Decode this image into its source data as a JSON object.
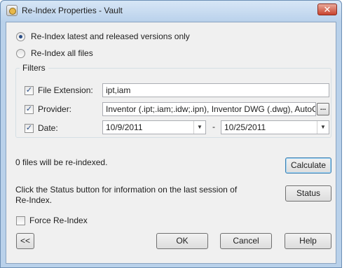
{
  "window": {
    "title": "Re-Index Properties - Vault",
    "close_glyph": "✕"
  },
  "options": {
    "latest_label": "Re-Index latest and released versions only",
    "all_label": "Re-Index all files"
  },
  "filters": {
    "group_label": "Filters",
    "file_extension": {
      "label": "File Extension:",
      "value": "ipt,iam",
      "checked": true
    },
    "provider": {
      "label": "Provider:",
      "value": "Inventor (.ipt;.iam;.idw;.ipn), Inventor DWG (.dwg), AutoCAD",
      "button": "...",
      "checked": true
    },
    "date": {
      "label": "Date:",
      "from": "10/9/2011",
      "separator": "-",
      "to": "10/25/2011",
      "checked": true
    }
  },
  "status_text": "0 files will be re-indexed.",
  "calculate_label": "Calculate",
  "status_info_line1": "Click the Status button for information on the last session of",
  "status_info_line2": "Re-Index.",
  "status_label": "Status",
  "force_label": "Force Re-Index",
  "buttons": {
    "collapse": "<<",
    "ok": "OK",
    "cancel": "Cancel",
    "help": "Help"
  },
  "check_glyph": "✓",
  "arrow_glyph": "▼"
}
